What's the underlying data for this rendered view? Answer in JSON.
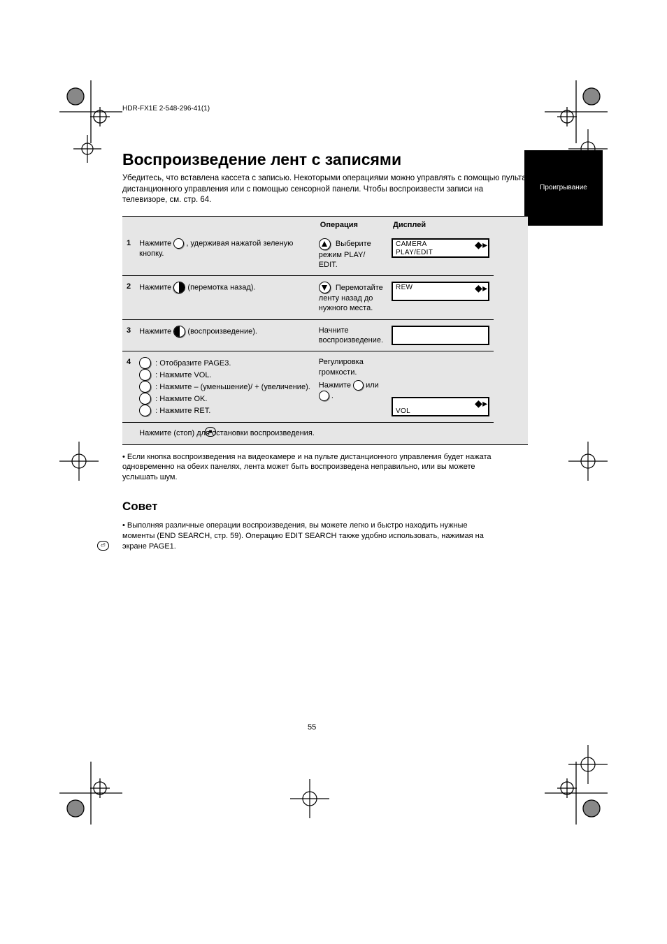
{
  "header_path": "HDR-FX1E 2-548-296-41(1)",
  "side_tab": "Проигрывание",
  "title": "Воспроизведение лент с записями",
  "intro": "Убедитесь, что вставлена кассета с записью. Некоторыми операциями можно управлять с помощью пульта дистанционного управления или с помощью сенсорной панели. Чтобы воспроизвести записи на телевизоре, см. стр. 64.",
  "table_header": {
    "step": "",
    "col2": "",
    "col3": "Операция",
    "col4": "Дисплей"
  },
  "rows": [
    {
      "num": "1",
      "col2_pre": "Нажмите ",
      "col2_post": ", удерживая нажатой зеленую кнопку.",
      "col3": "Выберите режим PLAY/ EDIT.",
      "lcd_r1": "CAMERA",
      "lcd_r2": "PLAY/EDIT"
    },
    {
      "num": "2",
      "col2_pre": "Нажмите ",
      "col2_label": "(перемотка назад).",
      "col3": "Перемотайте ленту назад до нужного места.",
      "lcd_r1": "REW",
      "lcd_r2": ""
    },
    {
      "num": "3",
      "col2_pre": "Нажмите ",
      "col2_label": "(воспроизведение).",
      "col3": "Начните воспроизведение.",
      "lcd_r1": "",
      "lcd_r2": ""
    },
    {
      "num": "4",
      "col3_line1": "Регулировка громкости.",
      "col3_prefix": "Нажмите ",
      "col3_or": " или ",
      "col3_suffix": ".",
      "stack": [
        ": Отобразите PAGE3.",
        ": Нажмите VOL.",
        ": Нажмите – (уменьшение)/ + (увеличение).",
        ": Нажмите       OK.",
        ": Нажмите       RET."
      ],
      "lcd_r1": "",
      "lcd_r2": "VOL"
    }
  ],
  "after_table": "Нажмите       (стоп) для остановки воспроизведения.",
  "note1": "• Если кнопка воспроизведения на видеокамере и на пульте дистанционного управления будет нажата одновременно на обеих панелях, лента может быть воспроизведена неправильно, или вы можете услышать шум.",
  "tip_heading": "Совет",
  "tip_body": "• Выполняя различные операции воспроизведения, вы можете легко и быстро находить нужные моменты (",
  "tip_link_label": "END SEARCH",
  "tip_body_end": ", стр. 59). Операцию EDIT SEARCH также удобно использовать, нажимая        на экране PAGE1.",
  "page_number": "55"
}
